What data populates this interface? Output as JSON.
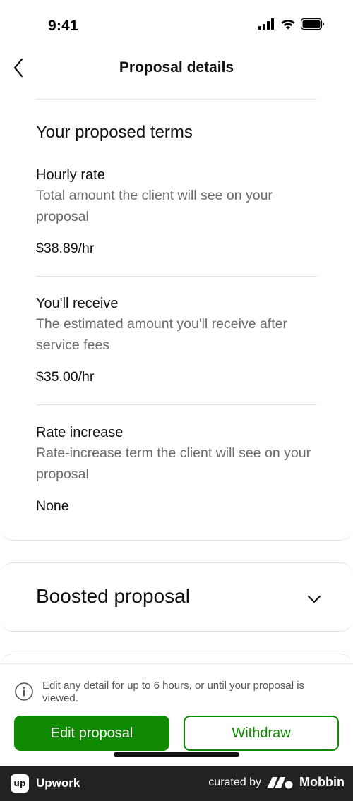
{
  "status_bar": {
    "time": "9:41",
    "icons": [
      "signal-icon",
      "wifi-icon",
      "battery-icon"
    ]
  },
  "nav": {
    "back_icon": "chevron-left-icon",
    "title": "Proposal details"
  },
  "terms": {
    "title": "Your proposed terms",
    "items": [
      {
        "label": "Hourly rate",
        "description": "Total amount the client will see on your proposal",
        "value": "$38.89/hr"
      },
      {
        "label": "You'll receive",
        "description": "The estimated amount you'll receive after service fees",
        "value": "$35.00/hr"
      },
      {
        "label": "Rate increase",
        "description": "Rate-increase term the client will see on your proposal",
        "value": "None"
      }
    ]
  },
  "boost": {
    "title": "Boosted proposal",
    "chevron_icon": "chevron-down-icon"
  },
  "footer": {
    "info_icon": "info-icon",
    "info_text": "Edit any detail for up to 6 hours, or until your proposal is viewed.",
    "edit_label": "Edit proposal",
    "withdraw_label": "Withdraw"
  },
  "brand_bar": {
    "app_badge": "up",
    "app_name": "Upwork",
    "curated_by": "curated by",
    "mobbin_name": "Mobbin"
  },
  "colors": {
    "accent_green": "#108a00",
    "text_primary": "#111111",
    "text_secondary": "#6b6b6b",
    "brand_bar": "#222222"
  }
}
